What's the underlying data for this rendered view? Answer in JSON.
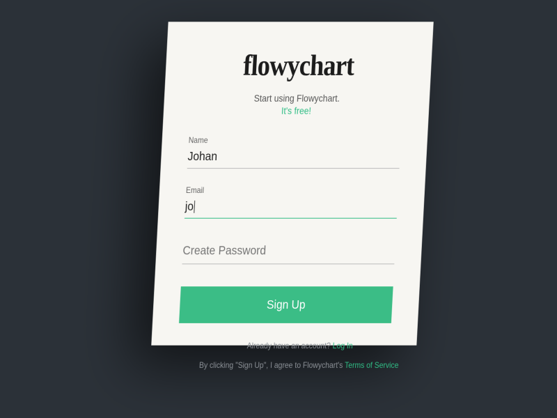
{
  "brand": "flowychart",
  "tagline": "Start using Flowychart.",
  "free_text": "It's free!",
  "fields": {
    "name": {
      "label": "Name",
      "value": "Johan"
    },
    "email": {
      "label": "Email",
      "value": "jo"
    },
    "password": {
      "placeholder": "Create Password"
    }
  },
  "signup_button": "Sign Up",
  "footer": {
    "already_text": "Already have an account? ",
    "login_link": "Log In",
    "terms_prefix": "By clicking \"Sign Up\", I agree to Flowychart's ",
    "terms_link": "Terms of Service"
  }
}
